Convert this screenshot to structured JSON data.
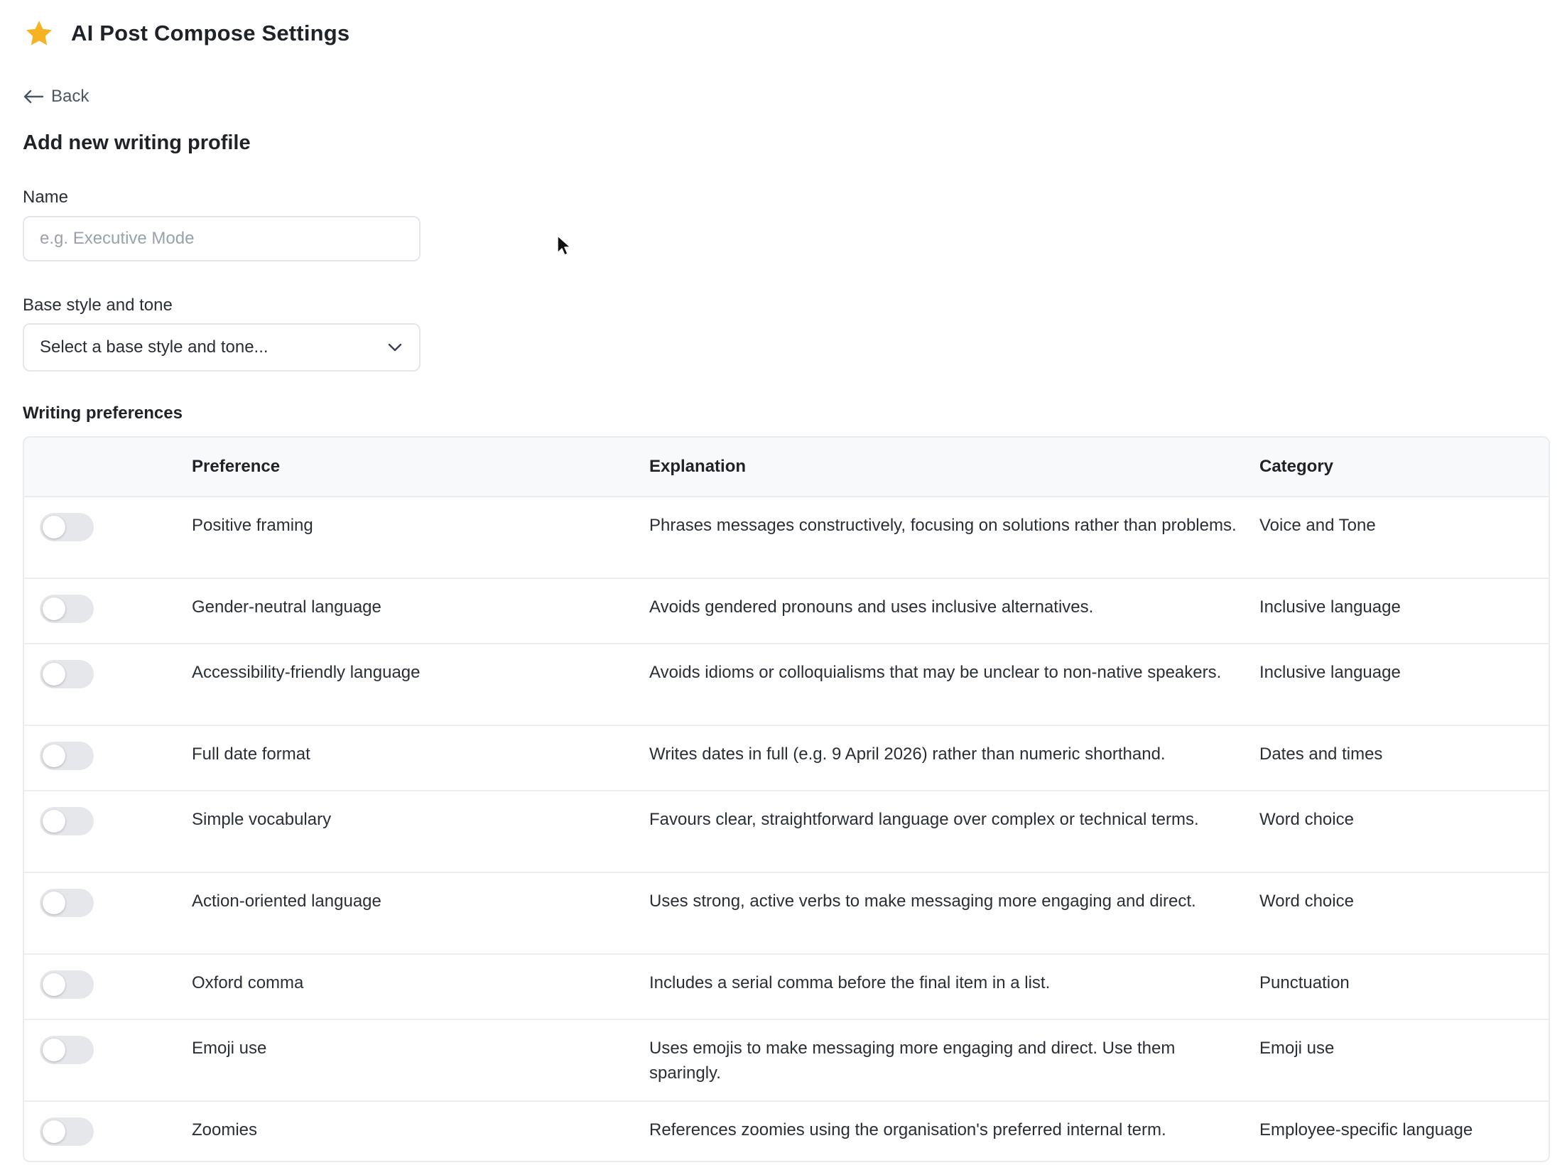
{
  "app": {
    "title": "AI Post Compose Settings",
    "icon": "star-icon",
    "accent_color": "#f5b324"
  },
  "back": {
    "label": "Back"
  },
  "form": {
    "title": "Add new writing profile",
    "name": {
      "label": "Name",
      "placeholder": "e.g. Executive Mode",
      "value": ""
    },
    "base_style": {
      "label": "Base style and tone",
      "selected": "Select a base style and tone..."
    }
  },
  "preferences": {
    "label": "Writing preferences",
    "columns": {
      "preference": "Preference",
      "explanation": "Explanation",
      "category": "Category"
    },
    "rows": [
      {
        "enabled": false,
        "preference": "Positive framing",
        "explanation": "Phrases messages constructively, focusing on solutions rather than problems.",
        "category": "Voice and Tone"
      },
      {
        "enabled": false,
        "preference": "Gender-neutral language",
        "explanation": "Avoids gendered pronouns and uses inclusive alternatives.",
        "category": "Inclusive language"
      },
      {
        "enabled": false,
        "preference": "Accessibility-friendly language",
        "explanation": "Avoids idioms or colloquialisms that may be unclear to non-native speakers.",
        "category": "Inclusive language"
      },
      {
        "enabled": false,
        "preference": "Full date format",
        "explanation": "Writes dates in full (e.g. 9 April 2026) rather than numeric shorthand.",
        "category": "Dates and times"
      },
      {
        "enabled": false,
        "preference": "Simple vocabulary",
        "explanation": "Favours clear, straightforward language over complex or technical terms.",
        "category": "Word choice"
      },
      {
        "enabled": false,
        "preference": "Action-oriented language",
        "explanation": "Uses strong, active verbs to make messaging more engaging and direct.",
        "category": "Word choice"
      },
      {
        "enabled": false,
        "preference": "Oxford comma",
        "explanation": "Includes a serial comma before the final item in a list.",
        "category": "Punctuation"
      },
      {
        "enabled": false,
        "preference": "Emoji use",
        "explanation": "Uses emojis to make messaging more engaging and direct. Use them sparingly.",
        "category": "Emoji use"
      },
      {
        "enabled": false,
        "preference": "Zoomies",
        "explanation": "References zoomies using the organisation's preferred internal term.",
        "category": "Employee-specific language"
      }
    ]
  }
}
